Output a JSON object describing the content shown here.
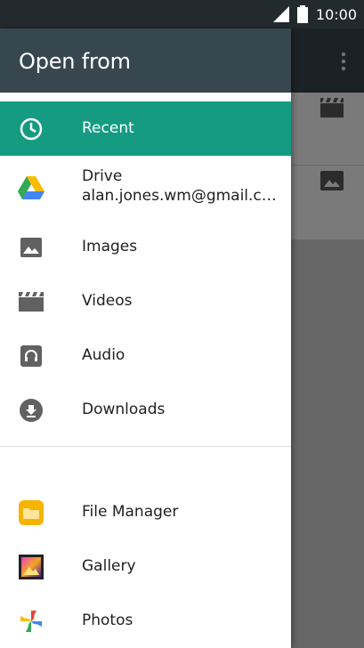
{
  "status_bar": {
    "time": "10:00"
  },
  "drawer": {
    "title": "Open from",
    "items": [
      {
        "label": "Recent",
        "icon": "clock-icon",
        "active": true
      },
      {
        "label": "Drive",
        "sublabel": "alan.jones.wm@gmail.co...",
        "icon": "google-drive-icon"
      },
      {
        "label": "Images",
        "icon": "image-icon"
      },
      {
        "label": "Videos",
        "icon": "video-icon"
      },
      {
        "label": "Audio",
        "icon": "headphones-icon"
      },
      {
        "label": "Downloads",
        "icon": "download-icon"
      }
    ],
    "apps": [
      {
        "label": "File Manager",
        "icon": "file-manager-icon"
      },
      {
        "label": "Gallery",
        "icon": "gallery-icon"
      },
      {
        "label": "Photos",
        "icon": "google-photos-icon"
      }
    ]
  },
  "colors": {
    "active": "#159b82",
    "header": "#37474f",
    "status_bar": "#232a2d"
  }
}
